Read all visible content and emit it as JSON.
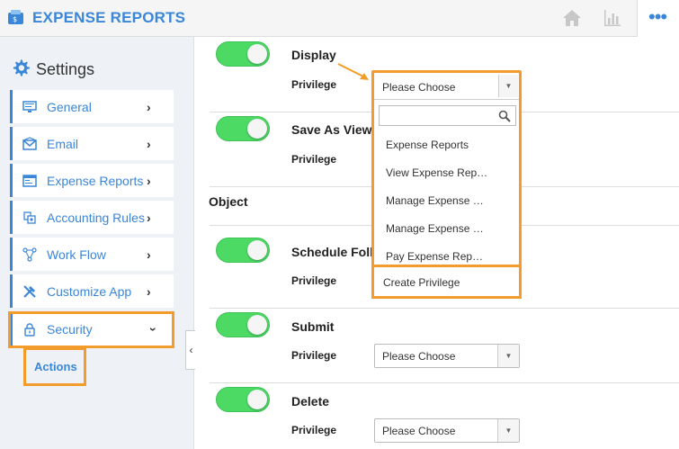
{
  "header": {
    "title": "EXPENSE REPORTS",
    "icons": [
      "wallet-logo-icon",
      "home-icon",
      "bar-chart-icon",
      "more-icon"
    ],
    "more_label": "•••"
  },
  "sidebar": {
    "title": "Settings",
    "items": [
      {
        "label": "General",
        "icon": "monitor-icon"
      },
      {
        "label": "Email",
        "icon": "envelope-icon"
      },
      {
        "label": "Expense Reports",
        "icon": "window-icon"
      },
      {
        "label": "Accounting Rules",
        "icon": "rules-icon"
      },
      {
        "label": "Work Flow",
        "icon": "workflow-icon"
      },
      {
        "label": "Customize App",
        "icon": "tools-icon"
      },
      {
        "label": "Security",
        "icon": "lock-icon"
      }
    ],
    "sub_item": "Actions",
    "collapse_glyph": "‹"
  },
  "main": {
    "rows": [
      {
        "title": "Display",
        "priv_label": "Privilege",
        "enabled": true
      },
      {
        "title": "Save As View",
        "priv_label": "Privilege",
        "enabled": true
      },
      {
        "title": "Schedule Follo",
        "priv_label": "Privilege",
        "enabled": true
      },
      {
        "title": "Submit",
        "priv_label": "Privilege",
        "enabled": true,
        "select": "Please Choose"
      },
      {
        "title": "Delete",
        "priv_label": "Privilege",
        "enabled": true,
        "select": "Please Choose"
      }
    ],
    "section_title": "Object"
  },
  "dropdown": {
    "selected": "Please Choose",
    "search_placeholder": "",
    "options": [
      "Expense Reports",
      "View Expense Rep…",
      "Manage Expense …",
      "Manage Expense …",
      "Pay Expense Rep…"
    ],
    "create_label": "Create Privilege"
  },
  "colors": {
    "accent": "#3a86d8",
    "highlight": "#f39c2c",
    "toggle_on": "#4cd964"
  }
}
